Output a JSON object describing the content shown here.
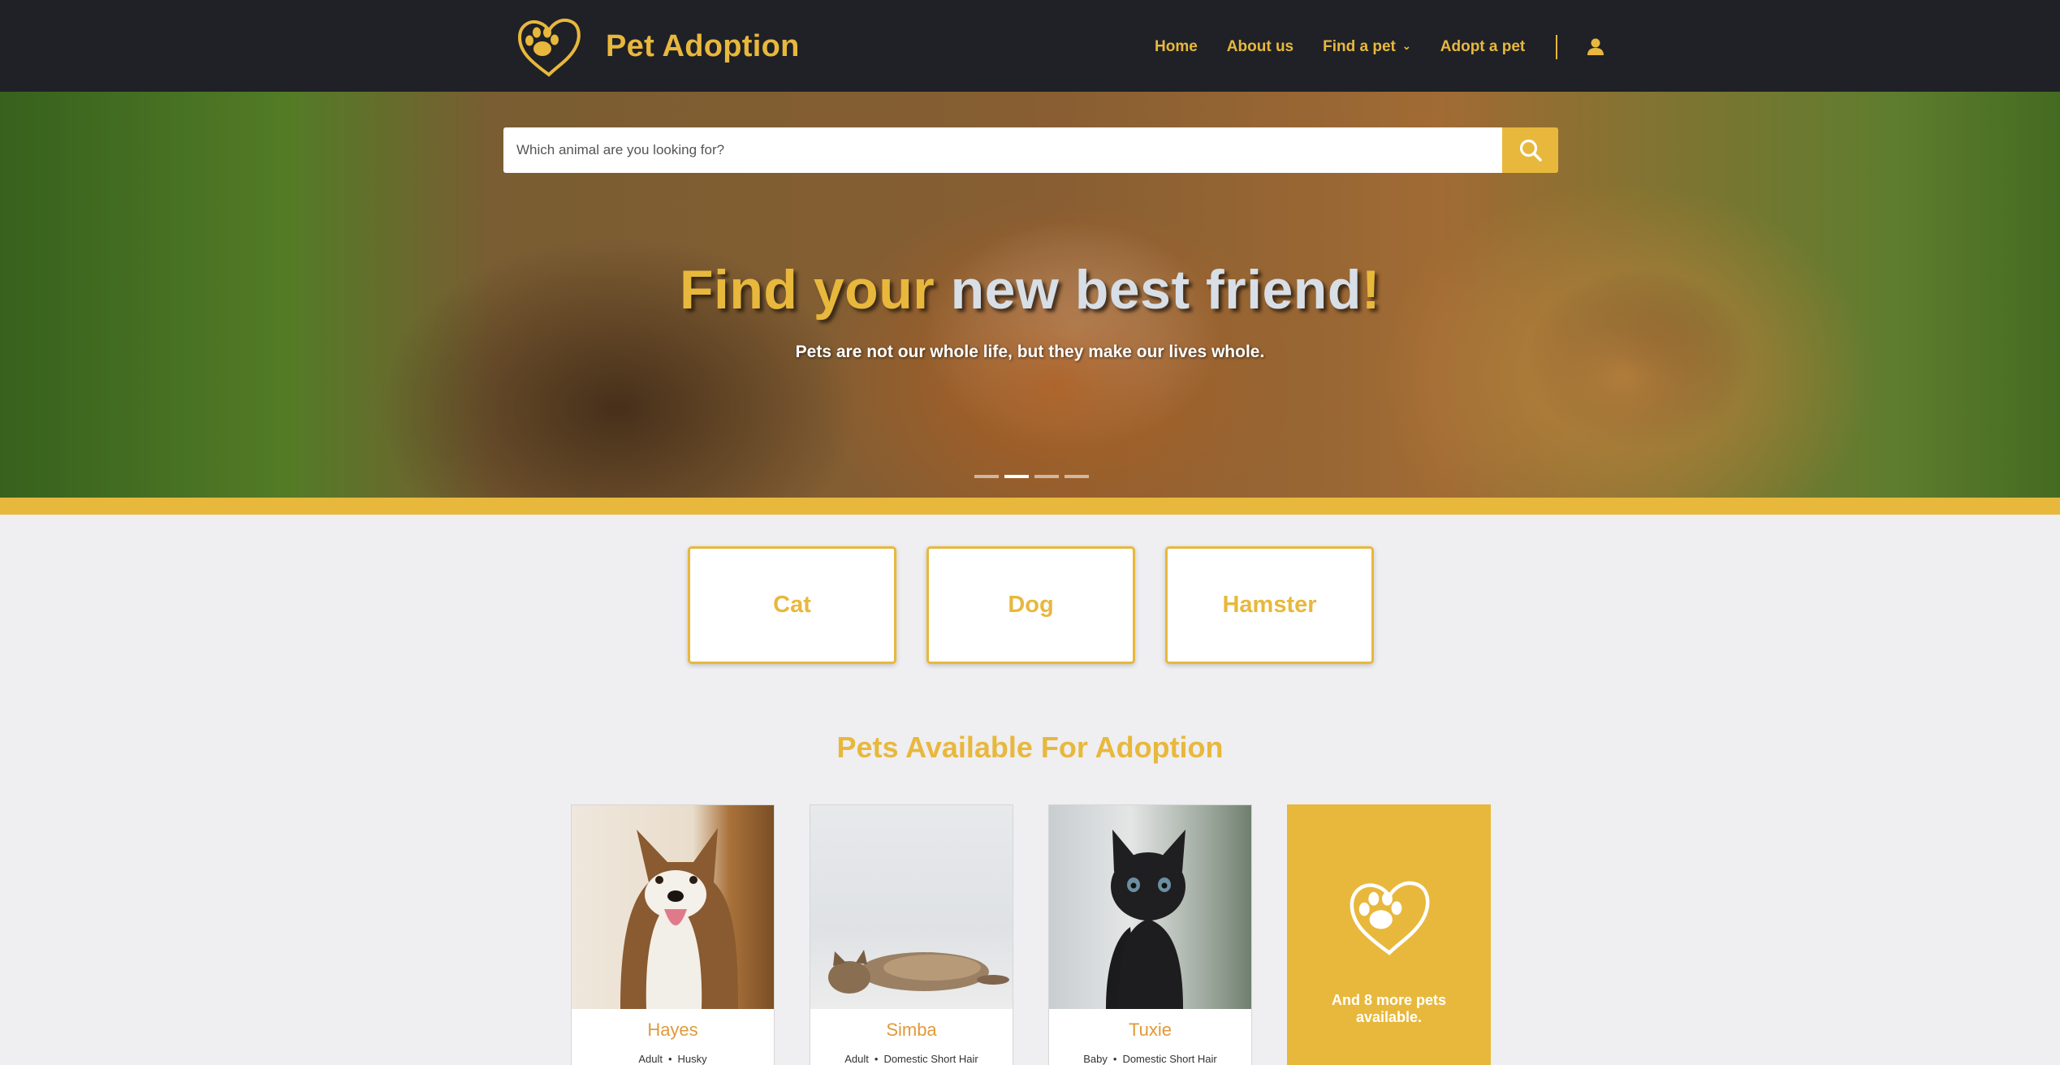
{
  "brand": {
    "name": "Pet Adoption",
    "accent": "#e8b83c",
    "nav_bg": "#1f2127"
  },
  "nav": {
    "home": "Home",
    "about": "About us",
    "find": "Find a pet",
    "adopt": "Adopt a pet",
    "user_icon": "user-icon"
  },
  "hero": {
    "search_placeholder": "Which animal are you looking for?",
    "search_icon": "search-icon",
    "title_part1": "Find your",
    "title_part2": " new best friend",
    "title_part3": "!",
    "subtitle": "Pets are not our whole life, but they make our lives whole.",
    "slides": 4,
    "active_slide": 2
  },
  "categories": [
    "Cat",
    "Dog",
    "Hamster"
  ],
  "section_title": "Pets Available For Adoption",
  "pets": [
    {
      "name": "Hayes",
      "age": "Adult",
      "breed": "Husky"
    },
    {
      "name": "Simba",
      "age": "Adult",
      "breed": "Domestic Short Hair"
    },
    {
      "name": "Tuxie",
      "age": "Baby",
      "breed": "Domestic Short Hair"
    }
  ],
  "more_pets": {
    "text": "And 8 more pets available."
  },
  "separator": "•"
}
